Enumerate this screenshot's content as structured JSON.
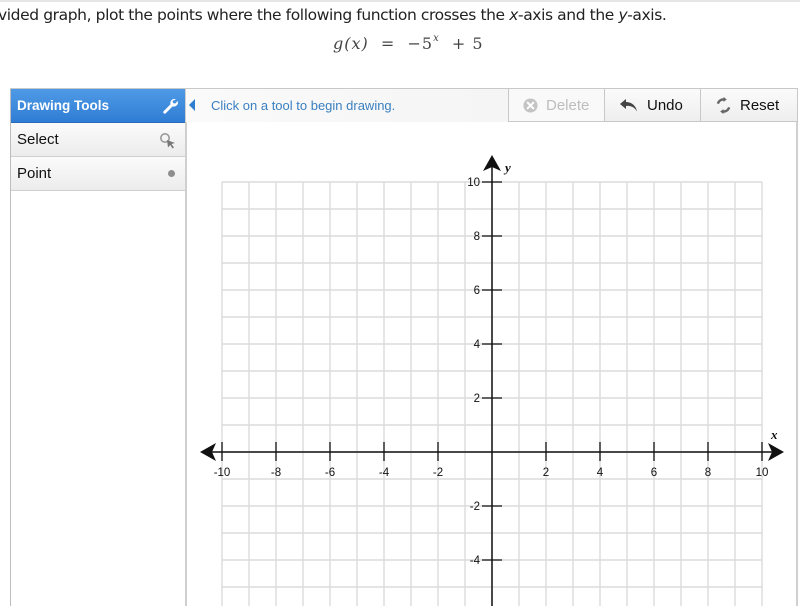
{
  "question": {
    "instruction_parts": [
      "vided graph, plot the points where the following function crosses the ",
      "x",
      "-axis and the ",
      "y",
      "-axis."
    ],
    "formula": {
      "lhs": "g(x)",
      "equals": "=",
      "base": "−5",
      "exponent": "x",
      "rest": "+ 5"
    }
  },
  "tools_panel": {
    "title": "Drawing Tools",
    "header_icon": "wrench-icon",
    "items": [
      {
        "label": "Select",
        "icon": "select-cursor-icon"
      },
      {
        "label": "Point",
        "icon": "point-dot-icon"
      }
    ]
  },
  "toolbar": {
    "hint": "Click on a tool to begin drawing.",
    "delete_label": "Delete",
    "delete_enabled": false,
    "undo_label": "Undo",
    "reset_label": "Reset"
  },
  "colors": {
    "header_blue": "#3a87da",
    "hint_blue": "#3a7fc0",
    "grid": "#dcdcdc",
    "axis": "#111111"
  },
  "chart_data": {
    "type": "scatter",
    "title": "",
    "xlabel": "x",
    "ylabel": "y",
    "xlim": [
      -10,
      10
    ],
    "ylim_visible": [
      -5.5,
      10
    ],
    "grid": true,
    "grid_step": 1,
    "x_ticks": [
      -10,
      -8,
      -6,
      -4,
      -2,
      2,
      4,
      6,
      8,
      10
    ],
    "x_tick_labels": [
      "-10",
      "-8",
      "-6",
      "-4",
      "-2",
      "2",
      "4",
      "6",
      "8",
      "10"
    ],
    "y_ticks": [
      10,
      8,
      6,
      4,
      2,
      -2,
      -4
    ],
    "y_tick_labels": [
      "10",
      "8",
      "6",
      "4",
      "2",
      "-2",
      "-4"
    ],
    "points": []
  }
}
